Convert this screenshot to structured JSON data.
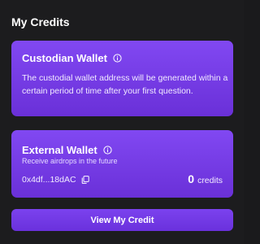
{
  "header": {
    "title": "My Credits"
  },
  "custodian": {
    "title": "Custodian Wallet",
    "description": "The custodial wallet address will be generated within a certain period of time after your first question.",
    "icon": "info-icon"
  },
  "external": {
    "title": "External Wallet",
    "subtitle": "Receive airdrops in the future",
    "address": "0x4df...18dAC",
    "credits_value": "0",
    "credits_unit": "credits",
    "icon": "info-icon",
    "copy_icon": "copy-icon"
  },
  "actions": {
    "view_credit": "View My Credit"
  },
  "colors": {
    "background": "#1c1c1e",
    "card_top": "#8148f2",
    "card_bottom": "#6a30d8",
    "text": "#ffffff"
  }
}
